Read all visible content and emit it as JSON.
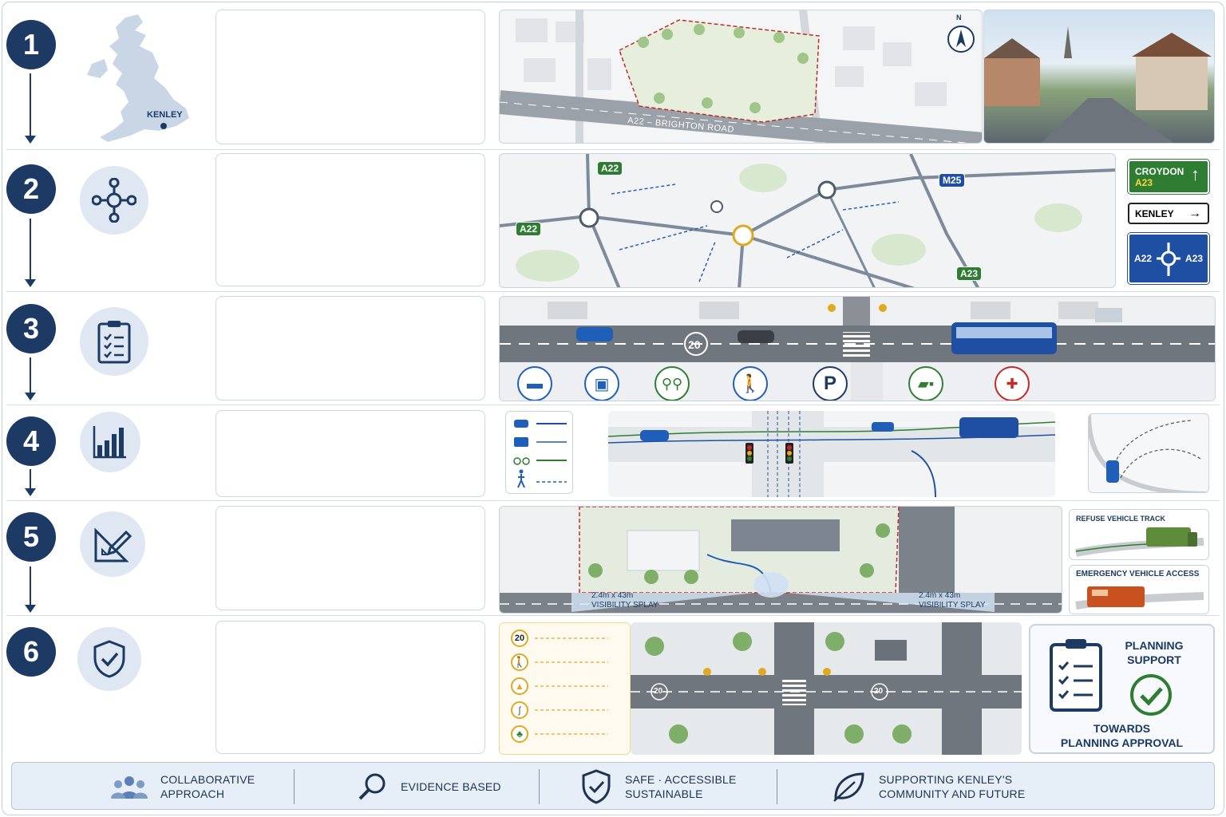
{
  "steps": [
    {
      "number": "1",
      "icon": "uk-map-icon",
      "location_label": "KENLEY"
    },
    {
      "number": "2",
      "icon": "network-node-icon"
    },
    {
      "number": "3",
      "icon": "clipboard-checklist-icon"
    },
    {
      "number": "4",
      "icon": "bar-chart-icon"
    },
    {
      "number": "5",
      "icon": "ruler-pencil-icon"
    },
    {
      "number": "6",
      "icon": "shield-check-icon"
    }
  ],
  "row1": {
    "road_label": "A22 – BRIGHTON ROAD",
    "north_label": "N"
  },
  "row2": {
    "road_badges": [
      "A22",
      "A22",
      "M25",
      "A23"
    ],
    "sign_croydon": "CROYDON",
    "sign_croydon_road": "A23",
    "sign_kenley": "KENLEY",
    "sign_roundabout_left": "A22",
    "sign_roundabout_right": "A23"
  },
  "row3": {
    "speed_marking": "20",
    "parking_letter": "P",
    "mode_icons": [
      "car-icon",
      "bus-icon",
      "bicycle-icon",
      "pedestrian-icon",
      "parking-icon",
      "lorry-icon",
      "ambulance-icon"
    ]
  },
  "row4": {
    "legend_icons": [
      "car-icon",
      "bus-icon",
      "bicycle-icon",
      "pedestrian-icon"
    ]
  },
  "row5": {
    "visibility_left": "2.4m x 43m\nVISIBILITY SPLAY",
    "visibility_right": "2.4m x 43m\nVISIBILITY SPLAY",
    "refuse_title": "REFUSE VEHICLE TRACK",
    "emergency_title": "EMERGENCY VEHICLE ACCESS"
  },
  "row6": {
    "speed_badge": "20",
    "road_speed_marking": "20",
    "planning_support": "PLANNING\nSUPPORT",
    "towards_approval": "TOWARDS\nPLANNING APPROVAL"
  },
  "footer": {
    "collaborative": "COLLABORATIVE\nAPPROACH",
    "evidence": "EVIDENCE BASED",
    "safe": "SAFE · ACCESSIBLE\nSUSTAINABLE",
    "supporting": "SUPPORTING KENLEY'S\nCOMMUNITY AND FUTURE"
  },
  "colors": {
    "navy": "#1c3a63",
    "road_green": "#2e7d32",
    "sign_blue": "#1f4fa3",
    "accent_amber": "#e0a920"
  }
}
